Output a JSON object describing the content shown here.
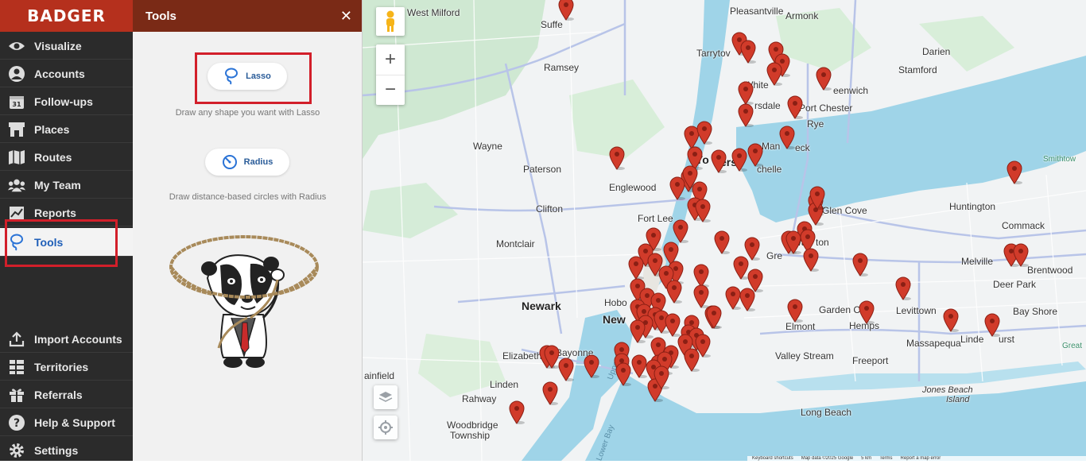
{
  "brand": {
    "logo_text": "BADGER",
    "color": "#b5301d"
  },
  "nav": {
    "items": [
      {
        "label": "Visualize",
        "icon": "eye-icon"
      },
      {
        "label": "Accounts",
        "icon": "user-circle-icon"
      },
      {
        "label": "Follow-ups",
        "icon": "calendar-icon"
      },
      {
        "label": "Places",
        "icon": "storefront-icon"
      },
      {
        "label": "Routes",
        "icon": "map-icon"
      },
      {
        "label": "My Team",
        "icon": "team-icon"
      },
      {
        "label": "Reports",
        "icon": "chart-icon"
      },
      {
        "label": "Tools",
        "icon": "lasso-icon",
        "active": true
      }
    ],
    "bottom_items": [
      {
        "label": "Import Accounts",
        "icon": "upload-icon"
      },
      {
        "label": "Territories",
        "icon": "grid-icon"
      },
      {
        "label": "Referrals",
        "icon": "gift-icon"
      },
      {
        "label": "Help & Support",
        "icon": "question-icon"
      },
      {
        "label": "Settings",
        "icon": "gear-icon"
      }
    ]
  },
  "panel": {
    "title": "Tools",
    "close_icon": "close-icon",
    "lasso": {
      "label": "Lasso",
      "description": "Draw any shape you want with Lasso"
    },
    "radius": {
      "label": "Radius",
      "description": "Draw distance-based circles with Radius"
    }
  },
  "map": {
    "places": [
      {
        "name": "West Milford"
      },
      {
        "name": "Suffe"
      },
      {
        "name": "Pleasantville"
      },
      {
        "name": "Armonk"
      },
      {
        "name": "Darien"
      },
      {
        "name": "Ramsey"
      },
      {
        "name": "Tarrytov"
      },
      {
        "name": "Stamford"
      },
      {
        "name": "White"
      },
      {
        "name": "eenwich"
      },
      {
        "name": "rsdale"
      },
      {
        "name": "Port Chester"
      },
      {
        "name": "Rye"
      },
      {
        "name": "Man"
      },
      {
        "name": "eck"
      },
      {
        "name": "Wayne"
      },
      {
        "name": "Yo"
      },
      {
        "name": "ers"
      },
      {
        "name": "Paterson"
      },
      {
        "name": "Englewood"
      },
      {
        "name": "chelle"
      },
      {
        "name": "Glen Cove"
      },
      {
        "name": "Huntington"
      },
      {
        "name": "Clifton"
      },
      {
        "name": "Fort Lee"
      },
      {
        "name": "Commack"
      },
      {
        "name": "Montclair"
      },
      {
        "name": "Wa"
      },
      {
        "name": "ton"
      },
      {
        "name": "Gre"
      },
      {
        "name": "Melville"
      },
      {
        "name": "Brentwood"
      },
      {
        "name": "Deer Park"
      },
      {
        "name": "Hobo"
      },
      {
        "name": "Newark"
      },
      {
        "name": "New"
      },
      {
        "name": "Garden City"
      },
      {
        "name": "Levittown"
      },
      {
        "name": "Bay Shore"
      },
      {
        "name": "Elmont"
      },
      {
        "name": "Hemps"
      },
      {
        "name": "Massapequa"
      },
      {
        "name": "Linde"
      },
      {
        "name": "urst"
      },
      {
        "name": "Elizabeth"
      },
      {
        "name": "Bayonne"
      },
      {
        "name": "Valley Stream"
      },
      {
        "name": "Freeport"
      },
      {
        "name": "ainfield"
      },
      {
        "name": "Linden"
      },
      {
        "name": "Jones Beach"
      },
      {
        "name": "Island"
      },
      {
        "name": "Rahway"
      },
      {
        "name": "Long Beach"
      },
      {
        "name": "Woodbridge"
      },
      {
        "name": "Township"
      },
      {
        "name": "Great"
      },
      {
        "name": "Smithtow"
      }
    ],
    "water_labels": [
      "Upper Bay",
      "Lower Bay"
    ],
    "footer": [
      "Keyboard shortcuts",
      "Map data ©2025 Google",
      "5 km",
      "Terms",
      "Report a map error"
    ],
    "pin_color": "#d13b2a",
    "controls": [
      "pegman-icon",
      "zoom-in-icon",
      "zoom-out-icon",
      "layers-icon",
      "locate-icon"
    ]
  }
}
